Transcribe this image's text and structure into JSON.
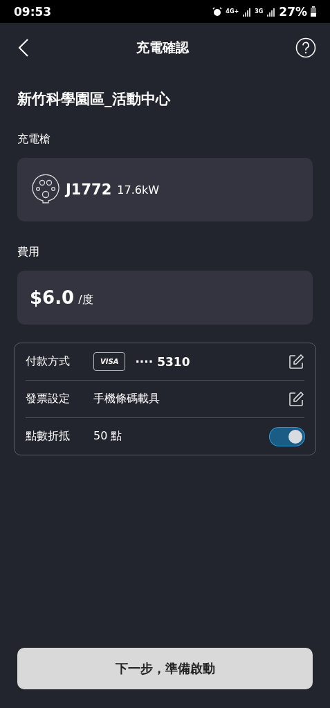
{
  "status_bar": {
    "time": "09:53",
    "network_1": "4G+",
    "network_2": "3G",
    "battery": "27%"
  },
  "header": {
    "title": "充電確認"
  },
  "station": {
    "name": "新竹科學園區_活動中心"
  },
  "connector": {
    "label": "充電槍",
    "type": "J1772",
    "power": "17.6kW"
  },
  "fee": {
    "label": "費用",
    "price": "$6.0",
    "unit": "/度"
  },
  "settings": [
    {
      "kind": "card",
      "label": "付款方式",
      "brand": "VISA",
      "value": "···· 5310"
    },
    {
      "kind": "text",
      "label": "發票設定",
      "value": "手機條碼載具"
    },
    {
      "kind": "toggle",
      "label": "點數折抵",
      "value": "50 點",
      "on": true
    }
  ],
  "next_button": "下一步，準備啟動"
}
